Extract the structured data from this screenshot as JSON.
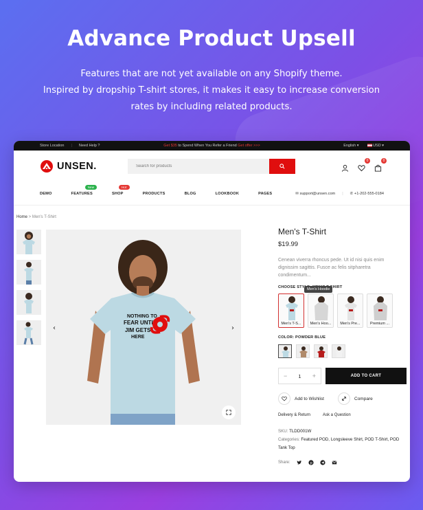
{
  "hero": {
    "title": "Advance Product Upsell",
    "subtitle_1": "Features that are not yet available on any Shopify theme.",
    "subtitle_2": "Inspired by dropship T-shirt stores, it makes it easy to increase conversion",
    "subtitle_3": "rates by including related products."
  },
  "topbar": {
    "store_location": "Store Location",
    "need_help": "Need Help ?",
    "promo_prefix": "Get $35",
    "promo_text": " to Spend When You Refer a Friend ",
    "promo_suffix": "Get offer >>>",
    "language": "English",
    "currency": "USD"
  },
  "header": {
    "logo_text": "UNSEN.",
    "search_placeholder": "Search for products",
    "wishlist_count": "0",
    "cart_count": "0"
  },
  "nav": {
    "items": [
      "DEMO",
      "FEATURES",
      "SHOP",
      "PRODUCTS",
      "BLOG",
      "LOOKBOOK",
      "PAGES"
    ],
    "features_badge": "New",
    "shop_badge": "Hot",
    "badge_colors": {
      "new": "#2bb24c",
      "hot": "#e53935"
    },
    "email": "support@unsen.com",
    "phone": "+1-202-555-0184"
  },
  "breadcrumb": {
    "home": "Home",
    "sep": " > ",
    "current": "Men's T-Shirt"
  },
  "product": {
    "title": "Men's T-Shirt",
    "price": "$19.99",
    "description": "Cenean viverra rhoncus pede. Ut id nisi quis enim dignissim sagittis. Fusce ac felis sitpharetra condimentum...",
    "choose_style_label": "CHOOSE STYLE: MEN'S T-SHIRT",
    "tooltip": "Men's Hoodie",
    "styles": [
      "Men's T-S...",
      "Men's Hoo...",
      "Men's Pre...",
      "Premium ..."
    ],
    "color_label": "COLOR: POWDER BLUE",
    "color_hex": [
      "#bcd9e3",
      "#b08a6a",
      "#b71c1c",
      "#f2f2f2"
    ],
    "quantity": "1",
    "add_to_cart": "ADD TO CART",
    "wishlist": "Add to Wishlist",
    "compare": "Compare",
    "delivery": "Delivery & Return",
    "ask": "Ask a Question",
    "sku_label": "SKU: ",
    "sku": "TLDD001W",
    "categories_label": "Categories: ",
    "categories": "Featured POD, Longsleeve Shirt, POD T-Shirt, POD Tank Top",
    "share_label": "Share:",
    "shirt_text_1": "NOTHING TO",
    "shirt_text_2": "FEAR UNTIL",
    "shirt_text_3": "JIM GETS",
    "shirt_text_4": "HERE"
  },
  "colors": {
    "accent": "#e00e0e",
    "hero_text": "#ffffff",
    "shirt": "#bcd9e3"
  }
}
